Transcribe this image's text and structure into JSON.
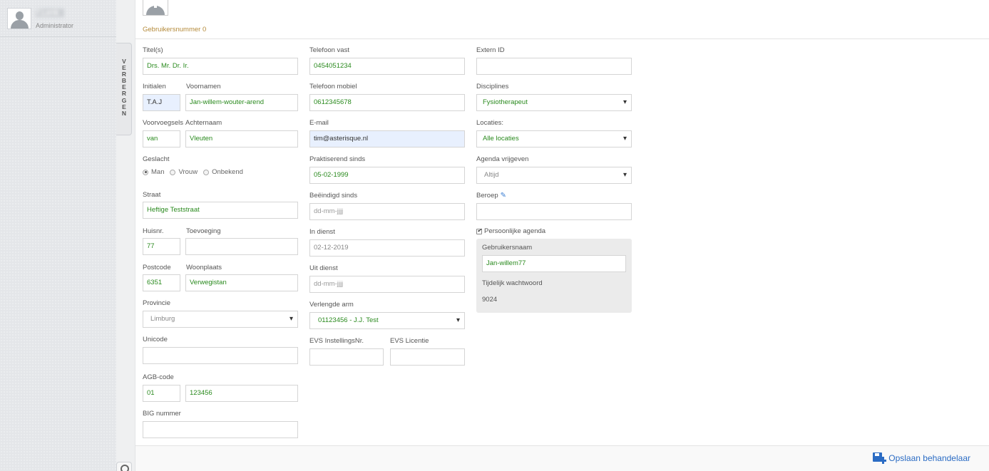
{
  "sidebar": {
    "user_name": "T.Lenk",
    "user_role": "Administrator",
    "collapse_label": "V\nE\nR\nB\nE\nR\nG\nE\nN"
  },
  "header": {
    "user_number": "Gebruikersnummer 0"
  },
  "form": {
    "col1": {
      "titles_label": "Titel(s)",
      "titles_value": "Drs. Mr. Dr. Ir.",
      "initials_label": "Initialen",
      "initials_value": "T.A.J",
      "firstnames_label": "Voornamen",
      "firstnames_value": "Jan-willem-wouter-arend",
      "prefix_label": "Voorvoegsels",
      "prefix_value": "van",
      "lastname_label": "Achternaam",
      "lastname_value": "Vleuten",
      "gender_label": "Geslacht",
      "gender_options": [
        "Man",
        "Vrouw",
        "Onbekend"
      ],
      "street_label": "Straat",
      "street_value": "Heftige Teststraat",
      "housenr_label": "Huisnr.",
      "housenr_value": "77",
      "addition_label": "Toevoeging",
      "addition_value": "",
      "postcode_label": "Postcode",
      "postcode_value": "6351",
      "city_label": "Woonplaats",
      "city_value": "Verwegistan",
      "province_label": "Provincie",
      "province_value": "Limburg",
      "unicode_label": "Unicode",
      "unicode_value": "",
      "agb_label": "AGB-code",
      "agb_prefix": "01",
      "agb_value": "123456",
      "big_label": "BIG nummer",
      "big_value": ""
    },
    "col2": {
      "phone_label": "Telefoon vast",
      "phone_value": "0454051234",
      "mobile_label": "Telefoon mobiel",
      "mobile_value": "0612345678",
      "email_label": "E-mail",
      "email_value": "tim@asterisque.nl",
      "practicing_label": "Praktiserend sinds",
      "practicing_value": "05-02-1999",
      "ended_label": "Beëindigd sinds",
      "ended_placeholder": "dd-mm-jjjj",
      "employed_label": "In dienst",
      "employed_value": "02-12-2019",
      "left_label": "Uit dienst",
      "left_placeholder": "dd-mm-jjjj",
      "arm_label": "Verlengde arm",
      "arm_value": "01123456 - J.J. Test",
      "evs_nr_label": "EVS InstellingsNr.",
      "evs_nr_value": "",
      "evs_license_label": "EVS Licentie",
      "evs_license_value": ""
    },
    "col3": {
      "external_id_label": "Extern ID",
      "external_id_value": "",
      "disciplines_label": "Disciplines",
      "disciplines_value": "Fysiotherapeut",
      "locations_label": "Locaties:",
      "locations_value": "Alle locaties",
      "agenda_label": "Agenda vrijgeven",
      "agenda_value": "Altijd",
      "profession_label": "Beroep",
      "profession_value": "",
      "personal_agenda_label": "Persoonlijke agenda",
      "username_label": "Gebruikersnaam",
      "username_value": "Jan-willem77",
      "temp_password_label": "Tijdelijk wachtwoord",
      "temp_password_value": "9024"
    }
  },
  "footer": {
    "save_label": "Opslaan behandelaar"
  },
  "colors": {
    "value_green": "#2a8a1e",
    "accent_blue": "#2b6cc4",
    "user_number_gold": "#b48a3a"
  }
}
